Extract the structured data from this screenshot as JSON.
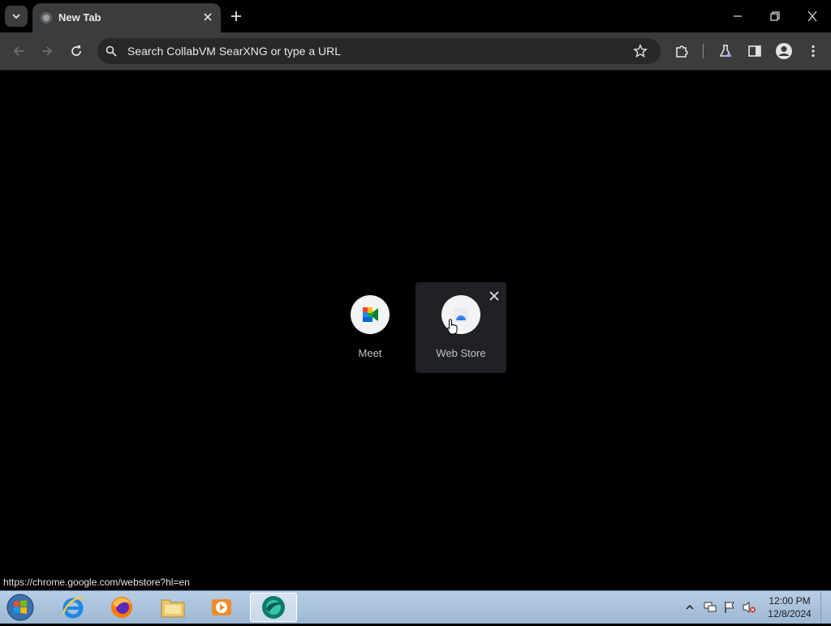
{
  "tab": {
    "title": "New Tab"
  },
  "omnibox": {
    "placeholder": "Search CollabVM SearXNG or type a URL"
  },
  "shortcuts": [
    {
      "label": "Meet"
    },
    {
      "label": "Web Store"
    }
  ],
  "status_url": "https://chrome.google.com/webstore?hl=en",
  "clock": {
    "time": "12:00 PM",
    "date": "12/8/2024"
  },
  "colors": {
    "frame": "#000000",
    "toolbar": "#3c3c3c",
    "omnibox": "#282828",
    "tile_hover": "#202124",
    "taskbar": "#b7cde4"
  },
  "icons": {
    "tab_search": "chevron-down-icon",
    "favicon": "globe-icon",
    "tab_close": "close-icon",
    "new_tab": "plus-icon",
    "minimize": "minimize-icon",
    "restore": "restore-icon",
    "close": "close-icon",
    "back": "back-arrow-icon",
    "forward": "forward-arrow-icon",
    "reload": "reload-icon",
    "search": "search-icon",
    "bookmark": "star-icon",
    "extensions": "puzzle-icon",
    "labs": "flask-icon",
    "side_panel": "side-panel-icon",
    "profile": "profile-icon",
    "menu": "kebab-menu-icon"
  }
}
